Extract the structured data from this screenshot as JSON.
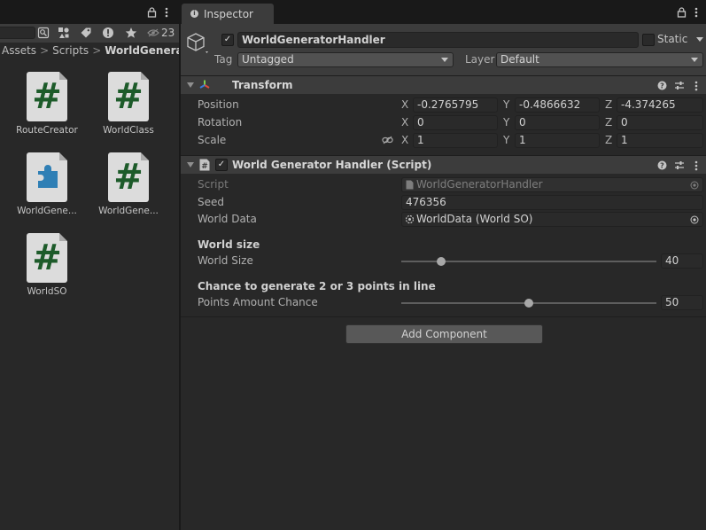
{
  "project": {
    "search_placeholder": "",
    "hidden_count": "23",
    "breadcrumb": [
      "Assets",
      "Scripts",
      "WorldGenerator"
    ],
    "assets": [
      {
        "name": "RouteCreator",
        "icon": "csharp-script-icon"
      },
      {
        "name": "WorldClass",
        "icon": "csharp-script-icon"
      },
      {
        "name": "WorldGene...",
        "icon": "puzzle-piece-icon"
      },
      {
        "name": "WorldGene...",
        "icon": "csharp-script-icon"
      },
      {
        "name": "WorldSO",
        "icon": "csharp-script-icon"
      }
    ]
  },
  "inspector": {
    "tab_label": "Inspector",
    "tab_icon": "info-icon",
    "object": {
      "name": "WorldGeneratorHandler",
      "active": true,
      "static_label": "Static",
      "static_checked": false,
      "tag_label": "Tag",
      "tag_value": "Untagged",
      "layer_label": "Layer",
      "layer_value": "Default"
    },
    "transform": {
      "title": "Transform",
      "rows": [
        {
          "label": "Position",
          "x": "-0.2765795",
          "y": "-0.4866632",
          "z": "-4.374265"
        },
        {
          "label": "Rotation",
          "x": "0",
          "y": "0",
          "z": "0"
        },
        {
          "label": "Scale",
          "x": "1",
          "y": "1",
          "z": "1"
        }
      ],
      "axis_x": "X",
      "axis_y": "Y",
      "axis_z": "Z"
    },
    "script_component": {
      "title": "World Generator Handler (Script)",
      "enabled": true,
      "script_label": "Script",
      "script_value": "WorldGeneratorHandler",
      "seed_label": "Seed",
      "seed_value": "476356",
      "world_data_label": "World Data",
      "world_data_value": "WorldData (World SO)",
      "world_size_header": "World size",
      "world_size_label": "World Size",
      "world_size_value": "40",
      "world_size_fraction": 0.145,
      "chance_header": "Chance to generate 2 or 3 points in line",
      "points_label": "Points Amount Chance",
      "points_value": "50",
      "points_fraction": 0.5
    },
    "add_component_label": "Add Component"
  },
  "colors": {
    "panel_bg": "#282828",
    "header_bg": "#3c3c3c",
    "tab_strip": "#191919",
    "script_hash_green": "#1d5b2a",
    "puzzle_blue": "#2f7fb5",
    "transform_x_red": "#e0493a",
    "transform_y_green": "#7fd04f",
    "transform_z_blue": "#3b7bd8"
  }
}
